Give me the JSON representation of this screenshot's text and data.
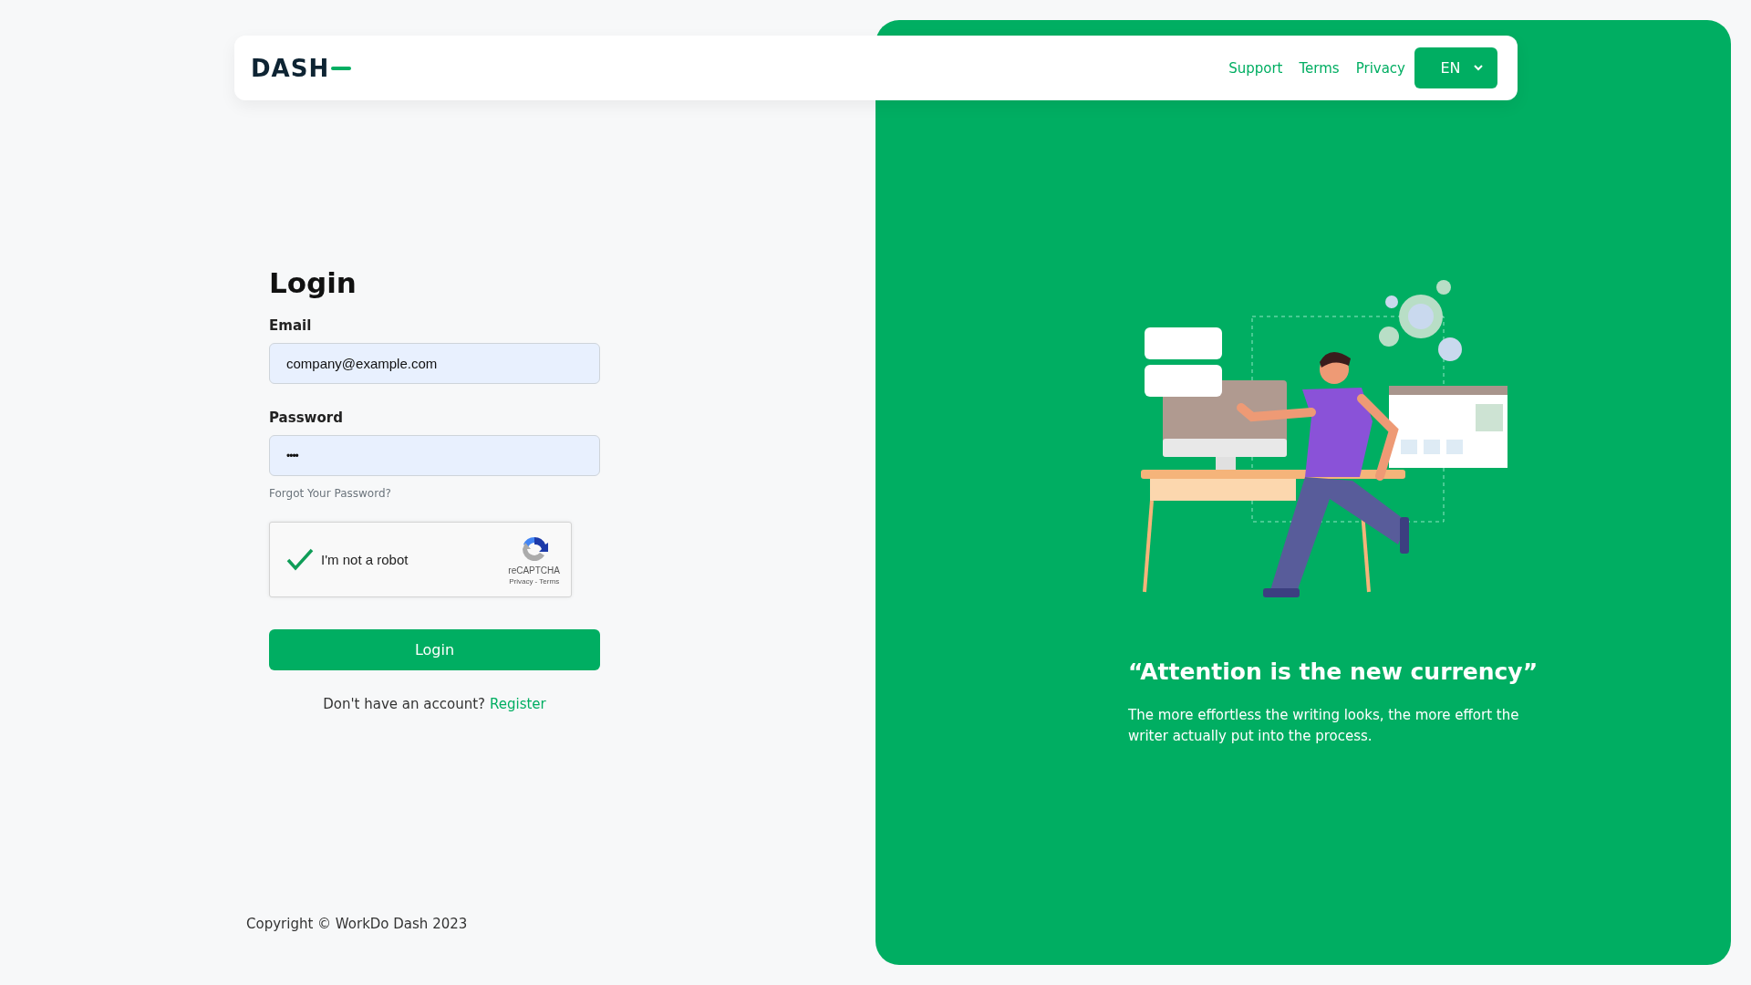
{
  "header": {
    "logo": "DASH",
    "links": [
      {
        "label": "Support"
      },
      {
        "label": "Terms"
      },
      {
        "label": "Privacy"
      }
    ],
    "language": "EN"
  },
  "login": {
    "title": "Login",
    "fields": [
      {
        "label": "Email",
        "value": "company@example.com",
        "kind": "text"
      },
      {
        "label": "Password",
        "value": "••••",
        "kind": "password"
      }
    ],
    "forgot_link": "Forgot Your Password?",
    "captcha": {
      "label": "I'm not a robot",
      "checked": true,
      "brand": "reCAPTCHA",
      "links": "Privacy - Terms"
    },
    "submit": "Login",
    "register_prompt": "Don't have an account?",
    "register_link": "Register"
  },
  "footer": {
    "copyright": "Copyright © WorkDo Dash 2023"
  },
  "promo": {
    "quote": "“Attention is the new currency”",
    "text": "The more effortless the writing looks, the more effort the writer actually put into the process."
  }
}
